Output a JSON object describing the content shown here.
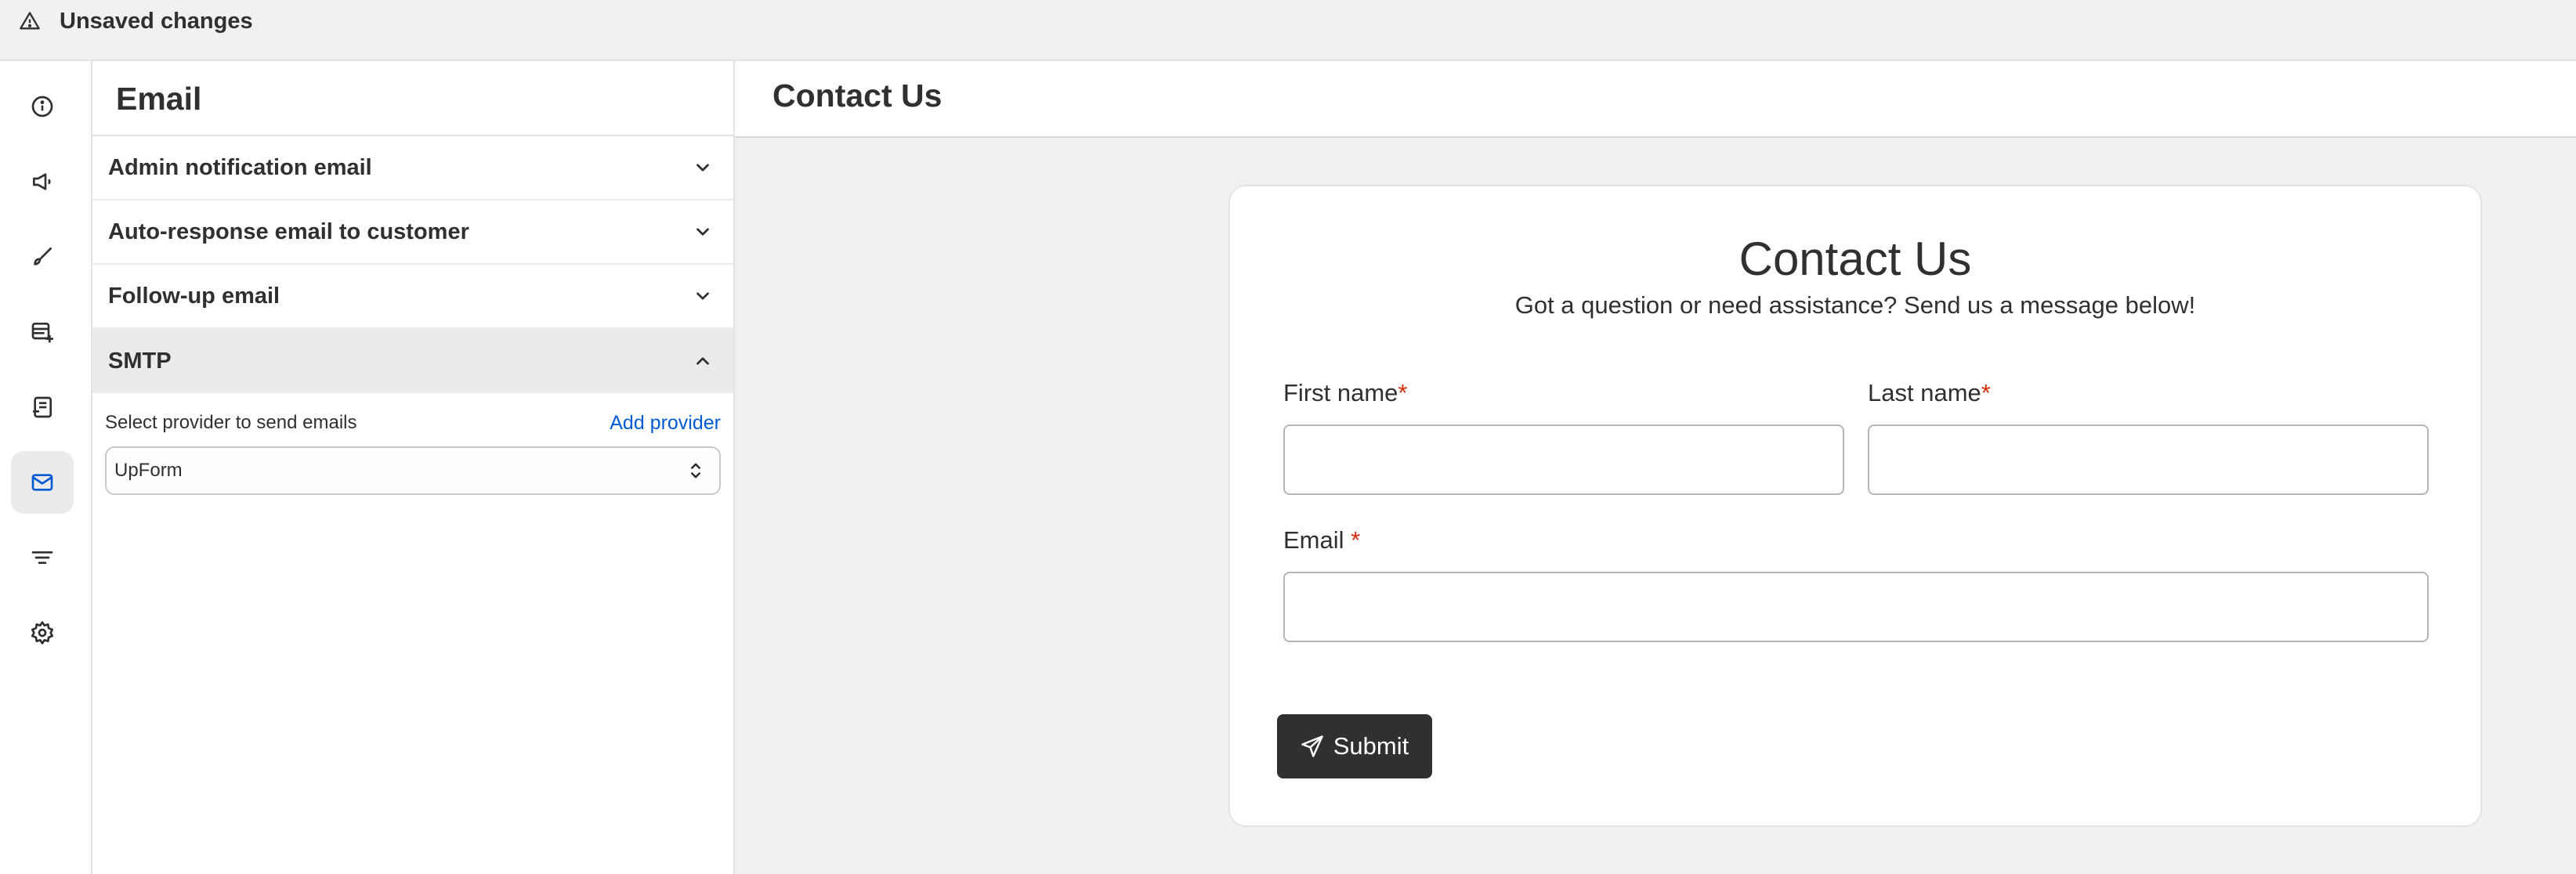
{
  "topbar": {
    "unsaved_label": "Unsaved changes",
    "icon": "warning-icon"
  },
  "rail": {
    "items": [
      {
        "icon": "info-icon"
      },
      {
        "icon": "megaphone-icon"
      },
      {
        "icon": "paintbrush-icon"
      },
      {
        "icon": "table-add-icon"
      },
      {
        "icon": "receipt-icon"
      },
      {
        "icon": "email-icon",
        "active": true
      },
      {
        "icon": "filter-icon"
      },
      {
        "icon": "gear-icon"
      }
    ]
  },
  "panel": {
    "title": "Email",
    "sections": [
      {
        "label": "Admin notification email",
        "expanded": false
      },
      {
        "label": "Auto-response email to customer",
        "expanded": false
      },
      {
        "label": "Follow-up email",
        "expanded": false
      },
      {
        "label": "SMTP",
        "expanded": true
      }
    ],
    "smtp": {
      "provider_label": "Select provider to send emails",
      "add_provider": "Add provider",
      "selected_provider": "UpForm"
    }
  },
  "main": {
    "header_title": "Contact Us",
    "form": {
      "title": "Contact Us",
      "subtitle": "Got a question or need assistance? Send us a message below!",
      "first_name_label": "First name",
      "last_name_label": "Last name",
      "email_label": "Email ",
      "required_mark": "*",
      "submit_label": "Submit"
    }
  },
  "colors": {
    "accent": "#005bd3",
    "required": "#d72c0d",
    "button": "#303030"
  }
}
